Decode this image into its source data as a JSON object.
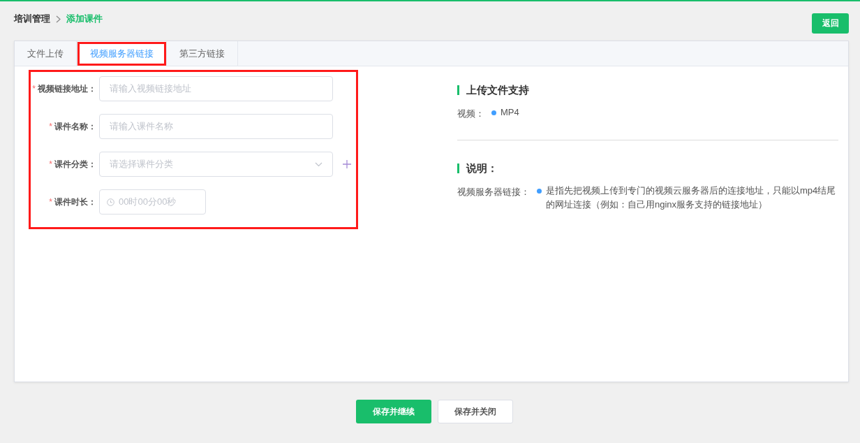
{
  "breadcrumb": [
    {
      "label": "培训管理",
      "current": false
    },
    {
      "label": "添加课件",
      "current": true
    }
  ],
  "back_button": "返回",
  "tabs": [
    {
      "label": "文件上传",
      "selected": false,
      "highlighted": false
    },
    {
      "label": "视频服务器链接",
      "selected": true,
      "highlighted": true
    },
    {
      "label": "第三方链接",
      "selected": false,
      "highlighted": false
    }
  ],
  "form": {
    "highlighted": true,
    "fields": [
      {
        "kind": "text",
        "label": "视频链接地址：",
        "required_mark": "*",
        "placeholder": "请输入视频链接地址"
      },
      {
        "kind": "text",
        "label": "课件名称：",
        "required_mark": "*",
        "placeholder": "请输入课件名称"
      },
      {
        "kind": "select",
        "label": "课件分类：",
        "required_mark": "*",
        "placeholder": "请选择课件分类"
      },
      {
        "kind": "time",
        "label": "课件时长：",
        "required_mark": "*",
        "placeholder": "00时00分00秒"
      }
    ]
  },
  "info": {
    "sections": [
      {
        "title": "上传文件支持",
        "rows": [
          {
            "label": "视频：",
            "items": [
              "MP4"
            ]
          }
        ]
      },
      {
        "title": "说明：",
        "rows": [
          {
            "label": "视频服务器链接：",
            "items": [
              "是指先把视频上传到专门的视频云服务器后的连接地址，只能以mp4结尾的网址连接（例如：自己用nginx服务支持的链接地址）"
            ]
          }
        ]
      }
    ]
  },
  "actions": [
    {
      "label": "保存并继续",
      "kind": "primary"
    },
    {
      "label": "保存并关闭",
      "kind": "default"
    }
  ]
}
